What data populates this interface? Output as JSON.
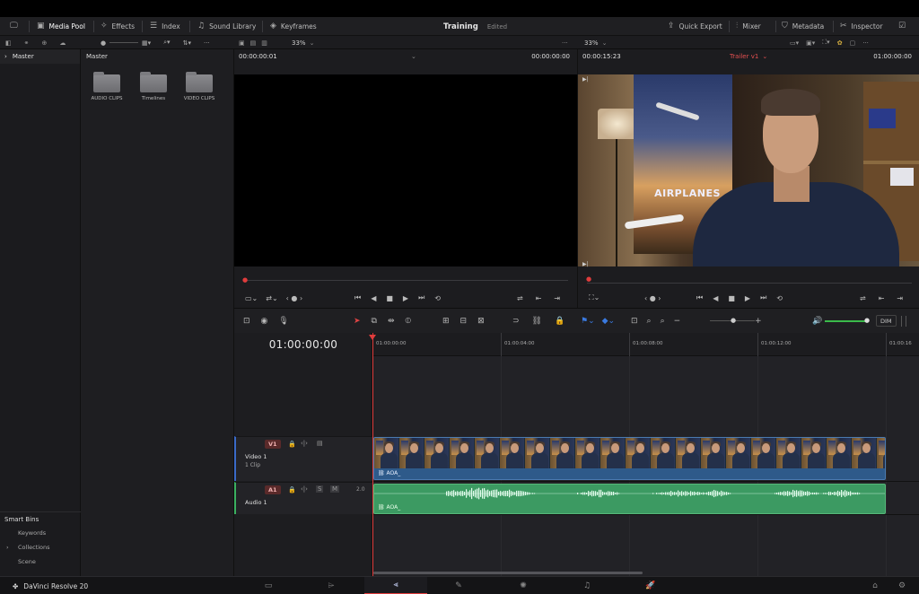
{
  "toolbar": {
    "media_pool": "Media Pool",
    "effects": "Effects",
    "index": "Index",
    "sound_library": "Sound Library",
    "keyframes": "Keyframes",
    "project_title": "Training",
    "project_status": "Edited",
    "quick_export": "Quick Export",
    "mixer": "Mixer",
    "metadata": "Metadata",
    "inspector": "Inspector"
  },
  "subbar": {
    "source_zoom": "33%",
    "timeline_zoom": "33%"
  },
  "sidebar": {
    "master_label": "Master",
    "smart_bins_title": "Smart Bins",
    "smart_bins": [
      "Keywords",
      "Collections",
      "Scene"
    ]
  },
  "pool": {
    "header": "Master",
    "folders": [
      "AUDIO CLIPS",
      "Timelines",
      "VIDEO CLIPS"
    ]
  },
  "source_viewer": {
    "left_timecode": "00:00:00:01",
    "right_timecode": "00:00:00:00"
  },
  "timeline_viewer": {
    "left_timecode": "00:00:15:23",
    "timeline_name": "Trailer v1",
    "right_timecode": "01:00:00:00",
    "poster_text": "AIRPLANES"
  },
  "edit_tools": {
    "dim_label": "DIM"
  },
  "timeline": {
    "current_timecode": "01:00:00:00",
    "ruler_ticks": [
      "01:00:00:00",
      "01:00:04:00",
      "01:00:08:00",
      "01:00:12:00",
      "01:00:16"
    ],
    "video_track": {
      "badge": "V1",
      "name": "Video 1",
      "sub": "1 Clip",
      "clip_name": "AOA_"
    },
    "audio_track": {
      "badge": "A1",
      "name": "Audio 1",
      "level": "2.0",
      "s_label": "S",
      "m_label": "M",
      "clip_name": "AOA_"
    }
  },
  "bottom": {
    "app_name": "DaVinci Resolve 20"
  },
  "colors": {
    "accent_red": "#e03c3c",
    "video_clip": "#2e5a8a",
    "audio_clip": "#3c9a62"
  }
}
